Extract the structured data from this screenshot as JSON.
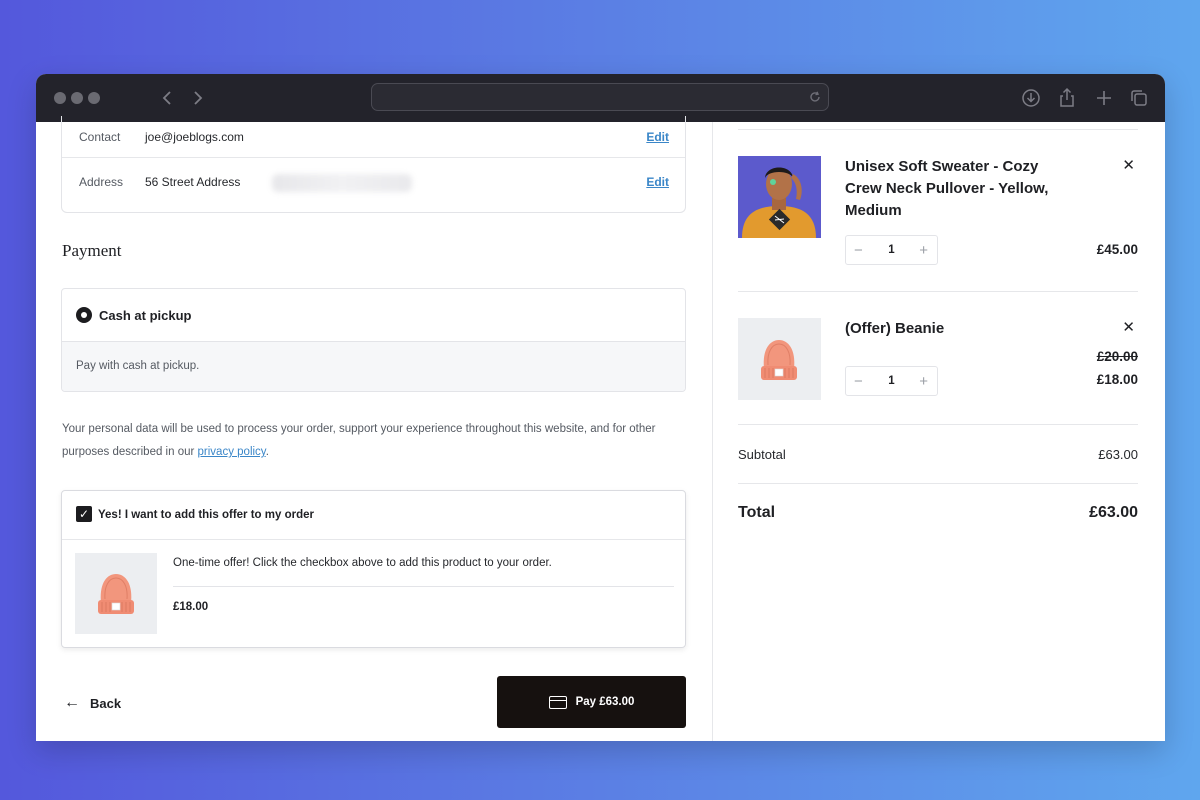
{
  "browser": {
    "icons": [
      "chevron-left-icon",
      "chevron-right-icon",
      "reload-icon",
      "download-icon",
      "share-icon",
      "plus-icon",
      "tabs-icon"
    ]
  },
  "contact": {
    "contact_label": "Contact",
    "contact_value": "joe@joeblogs.com",
    "address_label": "Address",
    "address_value": "56 Street Address",
    "edit_label": "Edit"
  },
  "payment": {
    "title": "Payment",
    "method_label": "Cash at pickup",
    "method_description": "Pay with cash at pickup."
  },
  "privacy": {
    "text_before": "Your personal data will be used to process your order, support your experience throughout this website, and for other purposes described in our ",
    "link_text": "privacy policy",
    "text_after": "."
  },
  "offer": {
    "checkbox_label": "Yes! I want to add this offer to my order",
    "checked": true,
    "description": "One-time offer! Click the checkbox above to add this product to your order.",
    "price": "£18.00"
  },
  "footer": {
    "back_label": "Back",
    "pay_label": "Pay £63.00"
  },
  "cart": {
    "items": [
      {
        "name": "Unisex Soft Sweater - Cozy Crew Neck Pullover - Yellow, Medium",
        "quantity": "1",
        "price": "£45.00",
        "original_price": ""
      },
      {
        "name": "(Offer) Beanie",
        "quantity": "1",
        "price": "£18.00",
        "original_price": "£20.00"
      }
    ],
    "subtotal_label": "Subtotal",
    "subtotal_value": "£63.00",
    "total_label": "Total",
    "total_value": "£63.00"
  },
  "colors": {
    "accent_link": "#3a86c8",
    "pay_button": "#16110f",
    "sweater": "#e29a2e",
    "beanie": "#f08c73"
  }
}
